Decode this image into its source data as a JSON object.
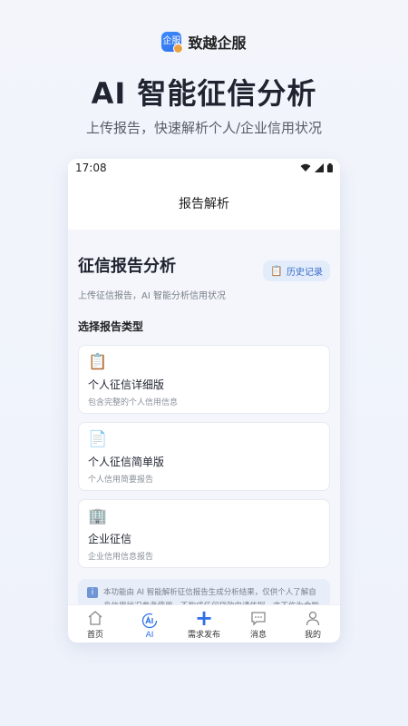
{
  "brand": {
    "logo_text": "企服",
    "name": "致越企服"
  },
  "hero": {
    "title": "AI 智能征信分析",
    "subtitle": "上传报告，快速解析个人/企业信用状况"
  },
  "status_bar": {
    "time": "17:08"
  },
  "nav": {
    "title": "报告解析"
  },
  "section": {
    "title": "征信报告分析",
    "subtitle": "上传征信报告，AI 智能分析信用状况",
    "history_label": "历史记录",
    "type_label": "选择报告类型"
  },
  "cards": [
    {
      "icon": "📋",
      "icon_name": "clipboard-icon",
      "title": "个人征信详细版",
      "desc": "包含完整的个人信用信息"
    },
    {
      "icon": "📄",
      "icon_name": "document-icon",
      "title": "个人征信简单版",
      "desc": "个人信用简要报告"
    },
    {
      "icon": "🏢",
      "icon_name": "building-icon",
      "title": "企业征信",
      "desc": "企业信用信息报告"
    }
  ],
  "notice": {
    "icon": "i",
    "text": "本功能由 AI 智能解析征信报告生成分析结果，仅供个人了解自身信用状况参考使用，不构成任何贷款申请依据，亦不作为金融机构审批的凭证。"
  },
  "tabs": [
    {
      "label": "首页",
      "icon": "home-icon"
    },
    {
      "label": "AI",
      "icon": "ai-icon"
    },
    {
      "label": "需求发布",
      "icon": "plus-icon"
    },
    {
      "label": "消息",
      "icon": "message-icon"
    },
    {
      "label": "我的",
      "icon": "user-icon"
    }
  ],
  "colors": {
    "accent": "#2f6fe8",
    "history_bg": "#e3ecfb",
    "notice_bg": "#e8eef9"
  }
}
